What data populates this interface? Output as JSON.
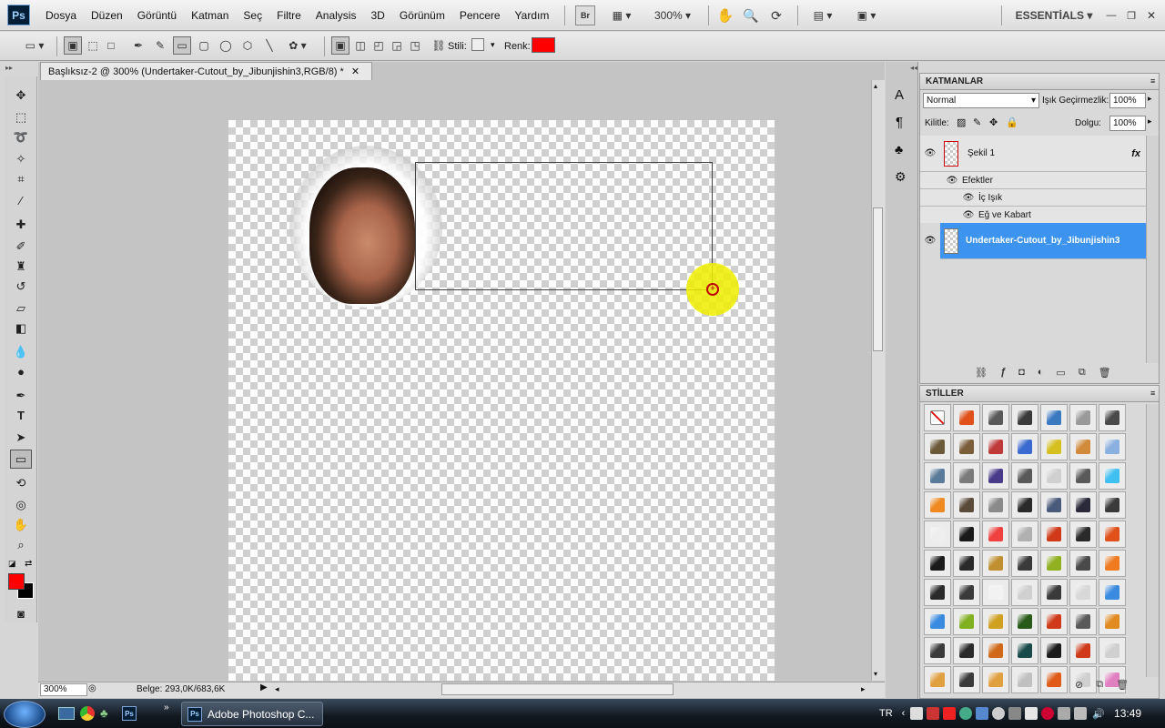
{
  "app": {
    "logo": "Ps"
  },
  "menu": [
    "Dosya",
    "Düzen",
    "Görüntü",
    "Katman",
    "Seç",
    "Filtre",
    "Analysis",
    "3D",
    "Görünüm",
    "Pencere",
    "Yardım"
  ],
  "appbar": {
    "bridge": "Br",
    "zoom": "300%",
    "workspace": "ESSENTİALS"
  },
  "options": {
    "style_label": "Stili:",
    "color_label": "Renk:",
    "color_value": "#ff0000"
  },
  "document": {
    "tab_title": "Başlıksız-2 @ 300% (Undertaker-Cutout_by_Jibunjishin3,RGB/8) *",
    "zoom": "300%",
    "doc_info": "Belge: 293,0K/683,6K"
  },
  "layers_panel": {
    "tab": "KATMANLAR",
    "blend_mode": "Normal",
    "opacity_label": "Işık Geçirmezlik:",
    "opacity": "100%",
    "lock_label": "Kilitle:",
    "fill_label": "Dolgu:",
    "fill": "100%",
    "layers": [
      {
        "name": "Şekil 1",
        "fx": "fx",
        "effects_label": "Efektler",
        "effects": [
          "İç Işık",
          "Eğ ve Kabart"
        ]
      },
      {
        "name": "Undertaker-Cutout_by_Jibunjishin3",
        "selected": true
      }
    ]
  },
  "styles_panel": {
    "tab": "STİLLER",
    "swatches": [
      "#ffffff",
      "#e0501a",
      "#5a5a5a",
      "#3a3a3a",
      "#3a78c0",
      "#9a9a9a",
      "#4a4a4a",
      "#6b5a3a",
      "#7a5e3a",
      "#c03a3a",
      "#3a6ad0",
      "#d6c020",
      "#d08a3a",
      "#8ab0e0",
      "#5a7a9a",
      "#7a7a7a",
      "#4a3a8a",
      "#5a5a5a",
      "#d0d0d0",
      "#5a5a5a",
      "#40c0f0",
      "#f08a20",
      "#5a4a3a",
      "#8a8a8a",
      "#2a2a2a",
      "#4a5a7a",
      "#2a2a3a",
      "#3a3a3a",
      "#eeeeee",
      "#1a1a1a",
      "#f04040",
      "#b0b0b0",
      "#d03a1a",
      "#2a2a2a",
      "#e0501a",
      "#1a1a1a",
      "#2a2a2a",
      "#c09030",
      "#3a3a3a",
      "#90b020",
      "#4a4a4a",
      "#f07a20",
      "#2a2a2a",
      "#3a3a3a",
      "#f2f2f2",
      "#d0d0d0",
      "#3a3a3a",
      "#d8d8d8",
      "#3a8ae0",
      "#3a8ae0",
      "#80b020",
      "#d0a020",
      "#2a5a1a",
      "#d03a1a",
      "#5a5a5a",
      "#e08a20",
      "#3a3a3a",
      "#2a2a2a",
      "#d06a1a",
      "#1a4a4a",
      "#1a1a1a",
      "#d03a1a",
      "#d0d0d0",
      "#e0a040",
      "#3a3a3a",
      "#e0a040",
      "#c0c0c0",
      "#e05a1a",
      "#d0d0d0",
      "#e080c0"
    ]
  },
  "taskbar": {
    "app_button": "Adobe Photoshop C...",
    "lang": "TR",
    "clock": "13:49"
  }
}
